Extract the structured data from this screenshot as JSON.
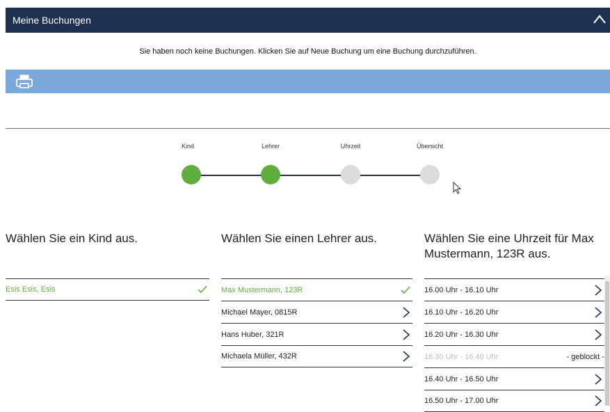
{
  "header": {
    "title": "Meine Buchungen",
    "collapse_icon": "chevron-up-icon"
  },
  "notice": "Sie haben noch keine Buchungen. Klicken Sie auf Neue Buchung um eine Buchung durchzuführen.",
  "printbar": {
    "icon": "printer-icon"
  },
  "stepper": {
    "steps": [
      {
        "label": "Kind",
        "done": true
      },
      {
        "label": "Lehrer",
        "done": true
      },
      {
        "label": "Uhrzeit",
        "done": false
      },
      {
        "label": "Übersicht",
        "done": false
      }
    ],
    "done_color": "#5fae3e",
    "todo_color": "#dcdcdc"
  },
  "kind_column": {
    "title": "Wählen Sie ein Kind aus.",
    "items": [
      {
        "label": "Esis Esis, Esis",
        "selected": true
      }
    ]
  },
  "lehrer_column": {
    "title": "Wählen Sie einen Lehrer aus.",
    "items": [
      {
        "label": "Max Mustermann, 123R",
        "selected": true
      },
      {
        "label": "Michael Mayer, 0815R",
        "selected": false
      },
      {
        "label": "Hans Huber, 321R",
        "selected": false
      },
      {
        "label": "Michaela Müller, 432R",
        "selected": false
      }
    ]
  },
  "uhrzeit_column": {
    "title": "Wählen Sie eine Uhrzeit für Max Mustermann, 123R aus.",
    "items": [
      {
        "label": "16.00 Uhr - 16.10 Uhr",
        "blocked": false
      },
      {
        "label": "16.10 Uhr - 16.20 Uhr",
        "blocked": false
      },
      {
        "label": "16.20 Uhr - 16.30 Uhr",
        "blocked": false
      },
      {
        "label": "16.30 Uhr - 16.40 Uhr",
        "blocked": true,
        "status": "- geblockt -"
      },
      {
        "label": "16.40 Uhr - 16.50 Uhr",
        "blocked": false
      },
      {
        "label": "16.50 Uhr - 17.00 Uhr",
        "blocked": false
      }
    ]
  },
  "colors": {
    "header_bg": "#1f3150",
    "printbar_bg": "#7aa7dc",
    "selected_green": "#5fae3e"
  }
}
